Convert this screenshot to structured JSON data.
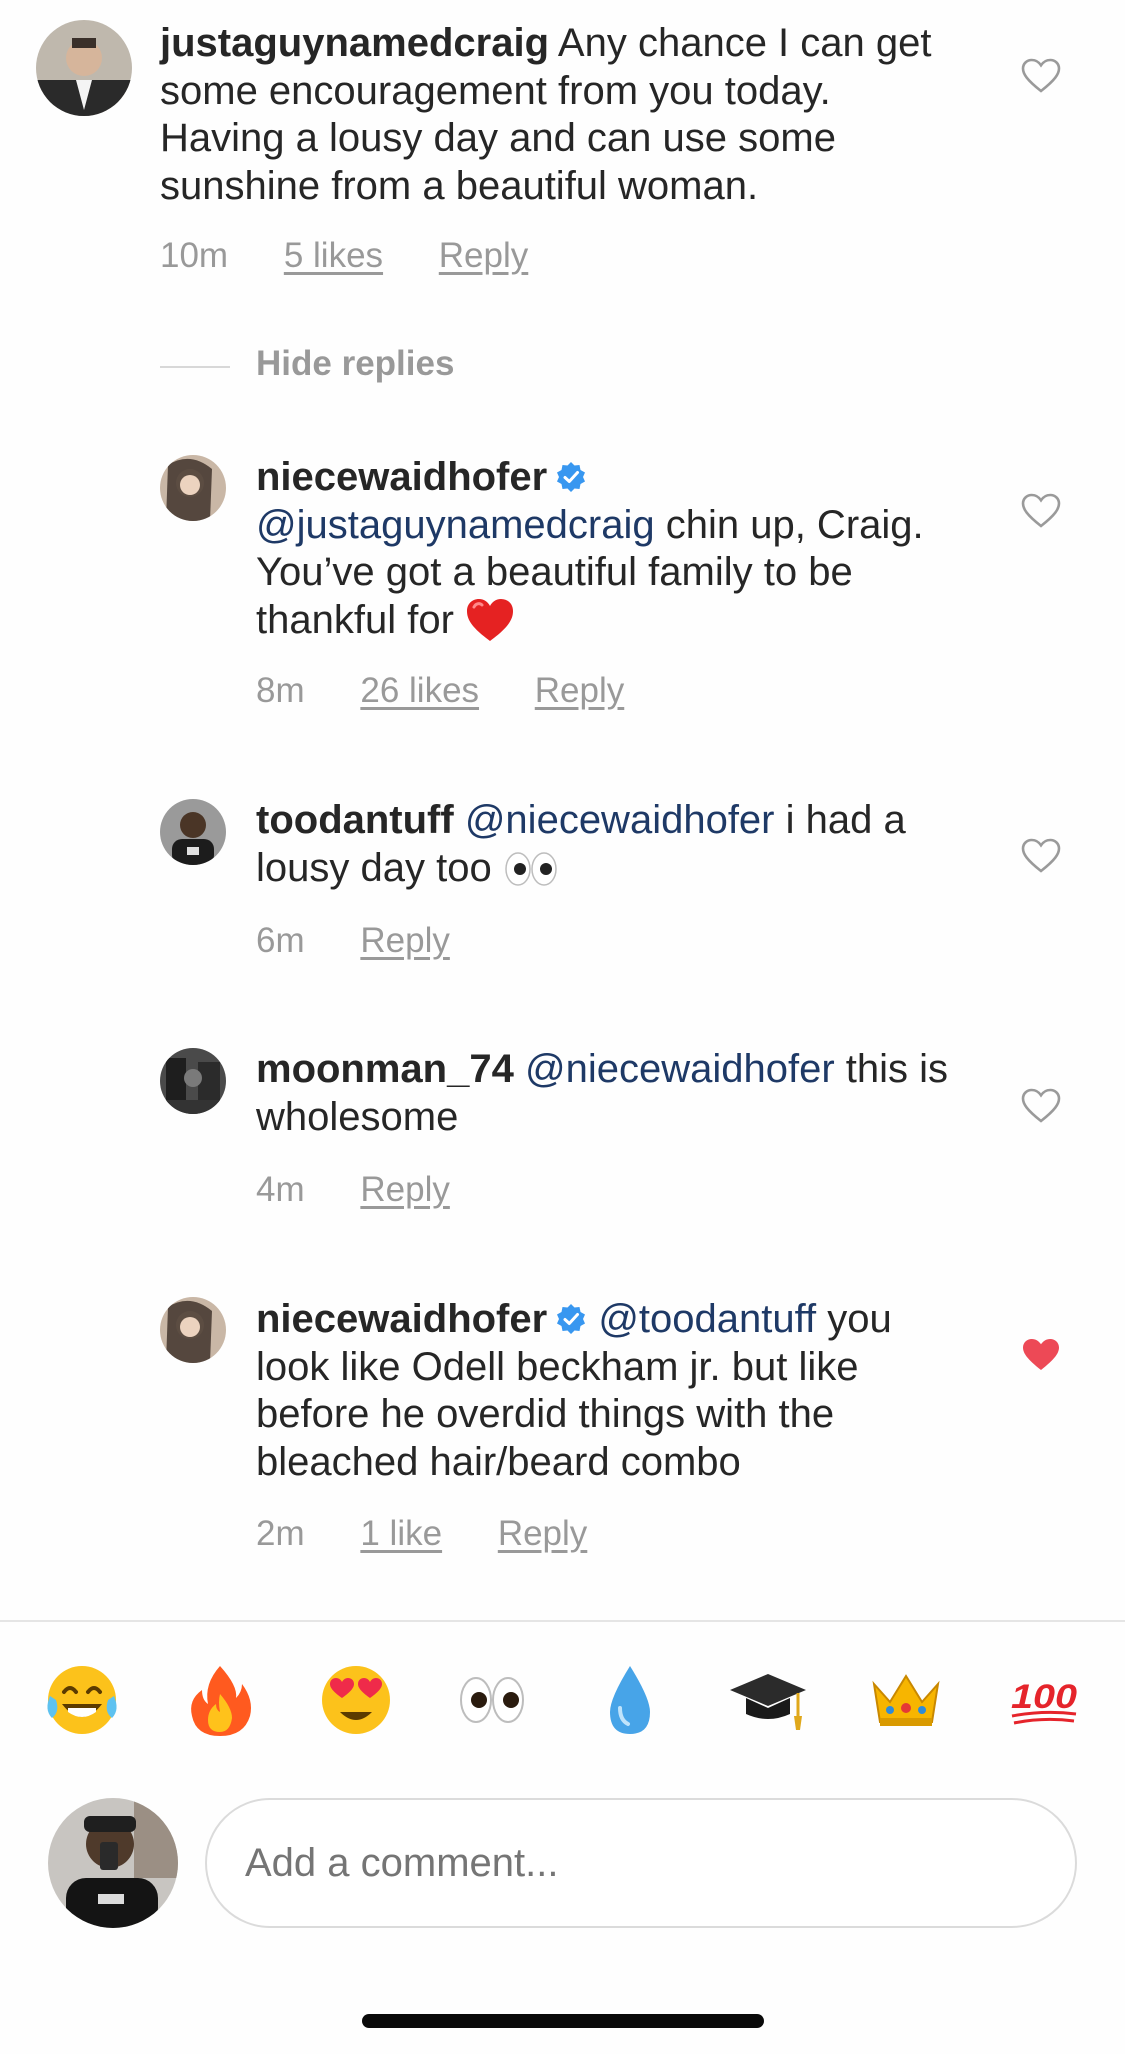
{
  "comments": [
    {
      "username": "justaguynamedcraig",
      "text": "Any chance I can get some encouragement from you today.  Having a lousy day and can use some sunshine from a beautiful woman.",
      "time": "10m",
      "likes": "5 likes",
      "reply": "Reply",
      "heart_icon": "heart-outline-icon"
    },
    {
      "username": "niecewaidhofer",
      "verified": true,
      "mention": "@justaguynamedcraig",
      "text": "chin up, Craig. You’ve got a beautiful family to be thankful for",
      "emoji": "red-heart-emoji",
      "time": "8m",
      "likes": "26 likes",
      "reply": "Reply",
      "heart_icon": "heart-outline-icon"
    },
    {
      "username": "toodantuff",
      "mention": "@niecewaidhofer",
      "text": "i had a lousy day too",
      "emoji": "eyes-emoji",
      "time": "6m",
      "reply": "Reply",
      "heart_icon": "heart-outline-icon"
    },
    {
      "username": "moonman_74",
      "mention": "@niecewaidhofer",
      "text": "this is wholesome",
      "time": "4m",
      "reply": "Reply",
      "heart_icon": "heart-outline-icon"
    },
    {
      "username": "niecewaidhofer",
      "verified": true,
      "mention": "@toodantuff",
      "text": "you look like Odell beckham jr. but like before he overdid things with the bleached hair/beard combo",
      "time": "2m",
      "likes": "1 like",
      "reply": "Reply",
      "heart_icon": "heart-filled-icon"
    }
  ],
  "hide_replies": "Hide replies",
  "emoji_bar": [
    "tears-of-joy-emoji",
    "fire-emoji",
    "heart-eyes-emoji",
    "eyes-emoji",
    "droplet-emoji",
    "graduation-cap-emoji",
    "crown-emoji",
    "hundred-points-emoji"
  ],
  "composer": {
    "placeholder": "Add a comment..."
  },
  "colors": {
    "mention": "#1e3966",
    "meta": "#999999",
    "like_red": "#ed4956",
    "verified": "#3897f0"
  }
}
